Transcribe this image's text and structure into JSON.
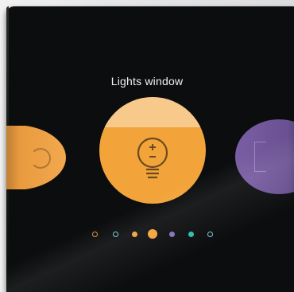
{
  "screen": {
    "title": "Lights window"
  },
  "carousel": {
    "tiles": [
      {
        "position": "left",
        "color": "#f0a13f",
        "icon": "power-icon"
      },
      {
        "position": "center",
        "color": "#f2a43a",
        "icon": "dimmer-bulb-icon",
        "selected": true
      },
      {
        "position": "right",
        "color": "#6f5599",
        "icon": "window-icon"
      }
    ]
  },
  "pager": {
    "dots": [
      {
        "style": "ring",
        "color": "#e0923a"
      },
      {
        "style": "ring",
        "color": "#7fc6d9"
      },
      {
        "style": "filled",
        "color": "#f0a13f"
      },
      {
        "style": "filled-large",
        "color": "#f2a43a",
        "active": true
      },
      {
        "style": "filled",
        "color": "#8a6fb8"
      },
      {
        "style": "filled",
        "color": "#2ebcae"
      },
      {
        "style": "ring",
        "color": "#7fc6d9"
      }
    ]
  },
  "colors": {
    "device_bg": "#0c0d0f",
    "accent_orange": "#f2a43a",
    "accent_purple": "#6f5599",
    "text": "#f2f2f2"
  }
}
